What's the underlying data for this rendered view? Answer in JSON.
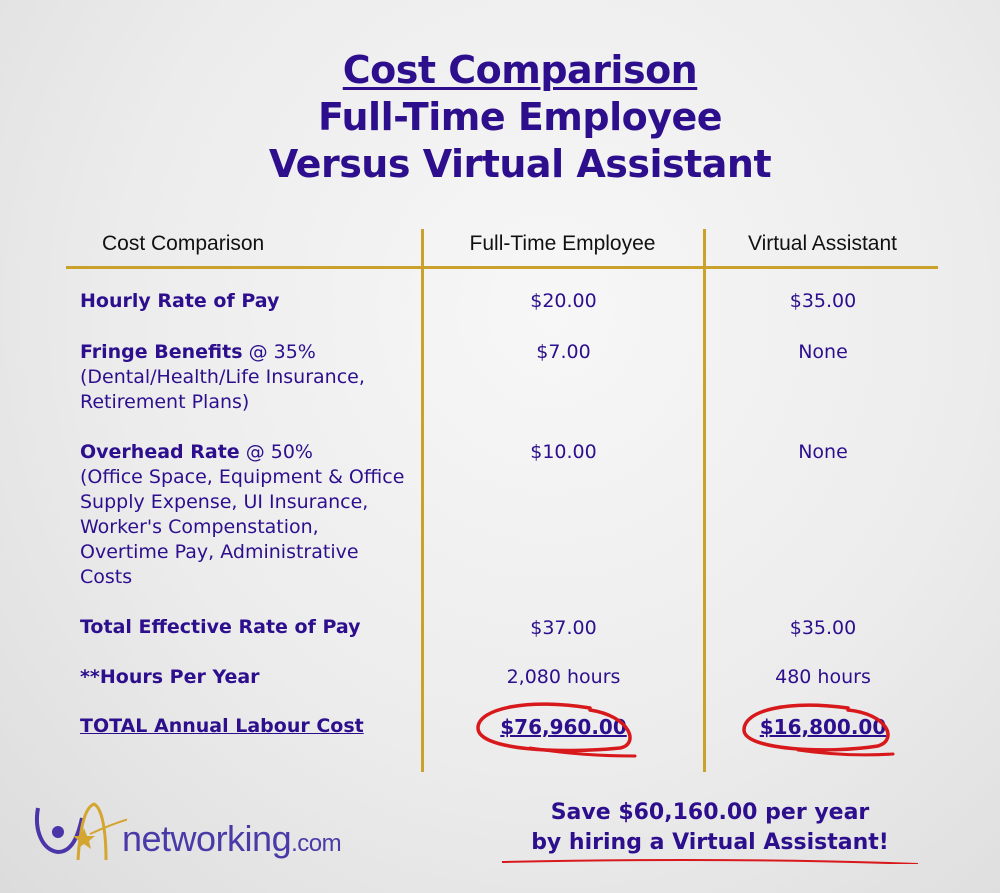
{
  "title": {
    "line1": "Cost Comparison",
    "line2": "Full-Time Employee",
    "line3": "Versus Virtual Assistant"
  },
  "table": {
    "headers": [
      "Cost Comparison",
      "Full-Time Employee",
      "Virtual Assistant"
    ],
    "rows": [
      {
        "label": "Hourly Rate of Pay",
        "qualifier": "",
        "detail": "",
        "fte": "$20.00",
        "va": "$35.00"
      },
      {
        "label": "Fringe Benefits",
        "qualifier": "@ 35%",
        "detail_lines": [
          "(Dental/Health/Life Insurance,",
          "Retirement Plans)"
        ],
        "fte": "$7.00",
        "va": "None"
      },
      {
        "label": "Overhead Rate",
        "qualifier": "@ 50%",
        "detail_lines": [
          "(Office Space, Equipment & Office",
          "Supply Expense, UI Insurance,",
          "Worker's Compenstation,",
          "Overtime Pay, Administrative",
          "Costs"
        ],
        "fte": "$10.00",
        "va": "None"
      },
      {
        "label": "Total Effective Rate of Pay",
        "fte": "$37.00",
        "va": "$35.00"
      },
      {
        "label": "**Hours Per Year",
        "fte": "2,080 hours",
        "va": "480 hours"
      },
      {
        "label": "TOTAL Annual Labour Cost",
        "fte": "$76,960.00",
        "va": "$16,800.00"
      }
    ]
  },
  "logo": {
    "text": "networking",
    "suffix": ".com"
  },
  "cta": {
    "line1": "Save $60,160.00 per year",
    "line2": "by hiring a Virtual Assistant!"
  },
  "colors": {
    "primary_text": "#2d0f8e",
    "rule": "#c9a12b",
    "highlight": "#d8191c"
  }
}
